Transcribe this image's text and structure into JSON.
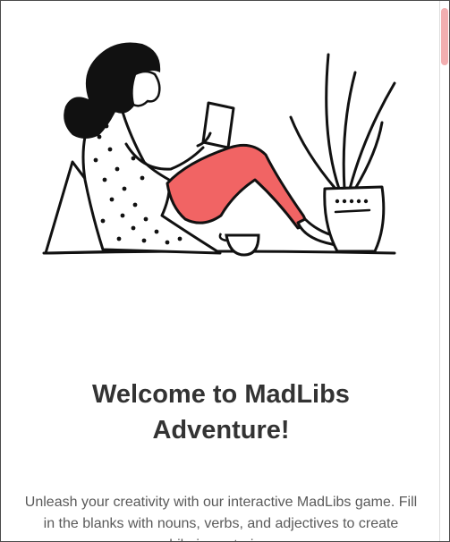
{
  "page": {
    "title": "Welcome to MadLibs\nAdventure!",
    "description": "Unleash your creativity with our interactive MadLibs game. Fill in the blanks with nouns, verbs, and adjectives to create hilarious stories."
  },
  "colors": {
    "accent": "#f16464",
    "text_title": "#333333",
    "text_body": "#5a5a5a",
    "scrollbar_thumb": "#f2aeb0"
  },
  "icons": {
    "hero": "woman-reading-illustration"
  }
}
